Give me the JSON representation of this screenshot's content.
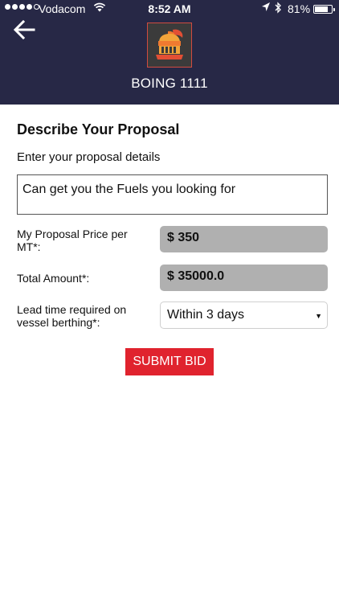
{
  "status_bar": {
    "carrier": "Vodacom",
    "time": "8:52 AM",
    "battery_text": "81%",
    "battery_level": 0.81,
    "icons": [
      "signal-dots-icon",
      "wifi-icon",
      "location-arrow-icon",
      "bluetooth-icon",
      "battery-icon"
    ]
  },
  "header": {
    "back_icon": "arrow-left-icon",
    "logo_icon": "knight-helmet-logo",
    "title": "BOING 1111",
    "background": "#272846"
  },
  "form": {
    "heading": "Describe Your Proposal",
    "subheading": "Enter your proposal details",
    "details_value": "Can get you the Fuels you looking for",
    "price_label": "My Proposal Price per MT*:",
    "price_value": "$ 350",
    "total_label": "Total Amount*:",
    "total_value": "$ 35000.0",
    "lead_time_label": "Lead time required on vessel berthing*:",
    "lead_time_value": "Within 3 days",
    "submit_label": "SUBMIT BID",
    "submit_color": "#e0232e"
  }
}
